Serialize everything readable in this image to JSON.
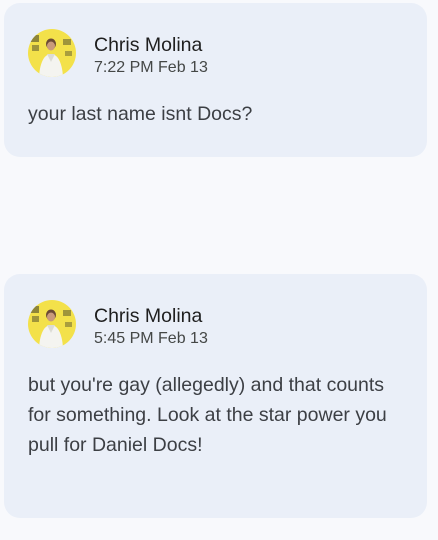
{
  "comments": [
    {
      "author": "Chris Molina",
      "time": "7:22 PM Feb 13",
      "text": "your last name isnt Docs?",
      "avatar_icon": "user-avatar-photo"
    },
    {
      "author": "Chris Molina",
      "time": "5:45 PM Feb 13",
      "text": "but you're gay (allegedly) and that counts for something. Look at the star power you pull for Daniel Docs!",
      "avatar_icon": "user-avatar-photo"
    }
  ],
  "colors": {
    "card_bg": "#eaeff8",
    "page_bg": "#f8f9fc",
    "avatar_bg": "#f3e14a"
  }
}
